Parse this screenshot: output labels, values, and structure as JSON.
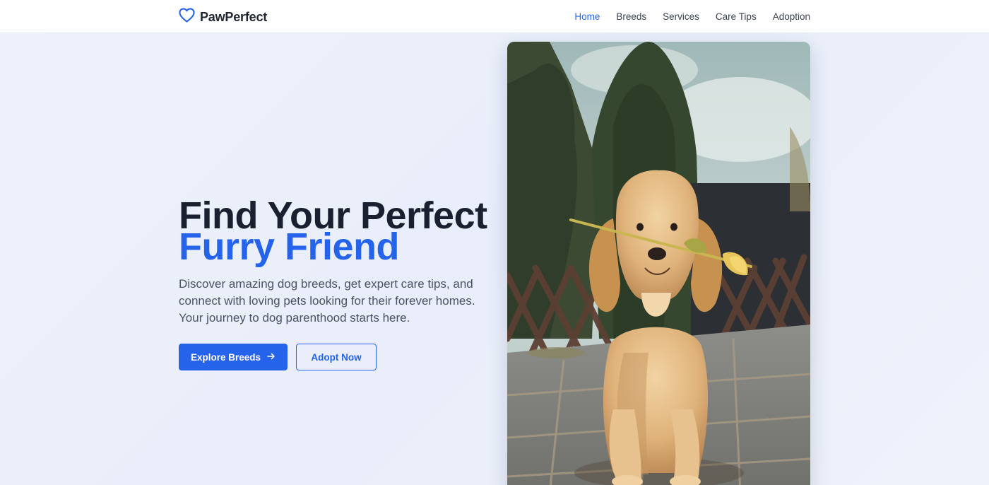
{
  "brand": {
    "name": "PawPerfect",
    "icon": "heart-icon",
    "accent": "#2563eb"
  },
  "nav": {
    "items": [
      {
        "label": "Home",
        "active": true
      },
      {
        "label": "Breeds",
        "active": false
      },
      {
        "label": "Services",
        "active": false
      },
      {
        "label": "Care Tips",
        "active": false
      },
      {
        "label": "Adoption",
        "active": false
      }
    ]
  },
  "hero": {
    "headline_line1": "Find Your Perfect",
    "headline_line2": "Furry Friend",
    "subtitle": "Discover amazing dog breeds, get expert care tips, and connect with loving pets looking for their forever homes. Your journey to dog parenthood starts here.",
    "primary_cta": "Explore Breeds",
    "primary_cta_icon": "arrow-right-icon",
    "secondary_cta": "Adopt Now",
    "image_subject": "golden retriever puppy holding a yellow tulip"
  },
  "colors": {
    "primary": "#2563eb",
    "text": "#1f2533",
    "muted": "#4a5263"
  }
}
